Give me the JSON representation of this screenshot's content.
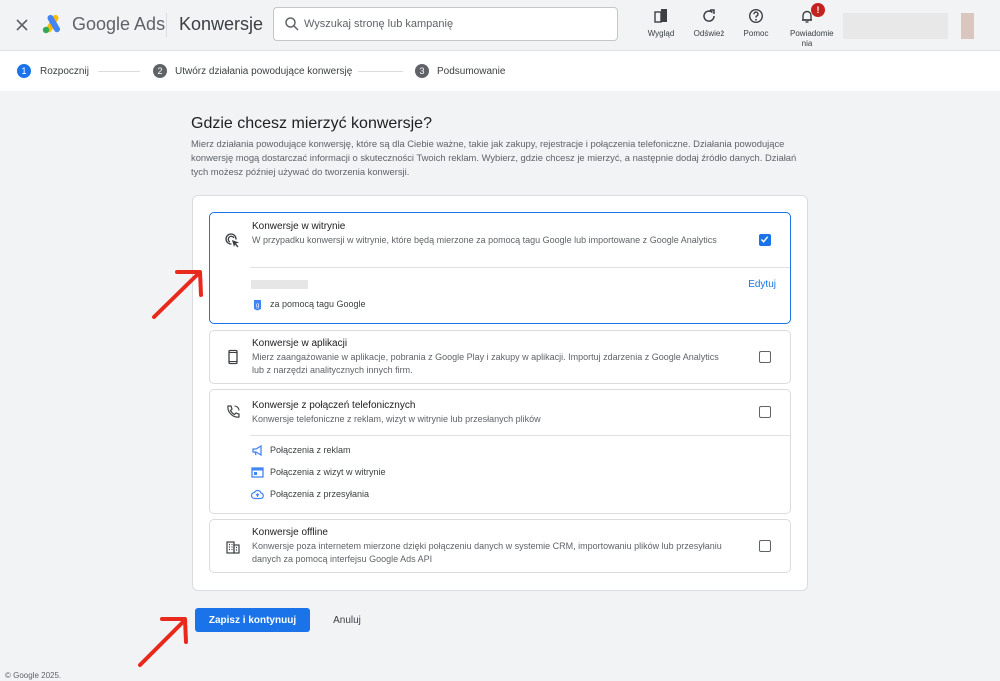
{
  "header": {
    "brand": "Google Ads",
    "page_title": "Konwersje",
    "search_placeholder": "Wyszukaj stronę lub kampanię",
    "tools": {
      "appearance": "Wygląd",
      "refresh": "Odśwież",
      "help": "Pomoc",
      "notifications": "Powiadomie nia",
      "notifications_badge": "!"
    }
  },
  "stepper": [
    {
      "num": "1",
      "label": "Rozpocznij"
    },
    {
      "num": "2",
      "label": "Utwórz działania powodujące konwersję"
    },
    {
      "num": "3",
      "label": "Podsumowanie"
    }
  ],
  "main": {
    "heading": "Gdzie chcesz mierzyć konwersje?",
    "intro": "Mierz działania powodujące konwersję, które są dla Ciebie ważne, takie jak zakupy, rejestracje i połączenia telefoniczne. Działania powodujące konwersję mogą dostarczać informacji o skuteczności Twoich reklam. Wybierz, gdzie chcesz je mierzyć, a następnie dodaj źródło danych. Działań tych możesz później używać do tworzenia konwersji."
  },
  "options": {
    "website": {
      "title": "Konwersje w witrynie",
      "desc": "W przypadku konwersji w witrynie, które będą mierzone za pomocą tagu Google lub importowane z Google Analytics",
      "edit": "Edytuj",
      "method": "za pomocą tagu Google",
      "checked": true
    },
    "app": {
      "title": "Konwersje w aplikacji",
      "desc": "Mierz zaangażowanie w aplikacje, pobrania z Google Play i zakupy w aplikacji. Importuj zdarzenia z Google Analytics lub z narzędzi analitycznych innych firm.",
      "checked": false
    },
    "calls": {
      "title": "Konwersje z połączeń telefonicznych",
      "desc": "Konwersje telefoniczne z reklam, wizyt w witrynie lub przesłanych plików",
      "sub": [
        "Połączenia z reklam",
        "Połączenia z wizyt w witrynie",
        "Połączenia z przesyłania"
      ],
      "checked": false
    },
    "offline": {
      "title": "Konwersje offline",
      "desc": "Konwersje poza internetem mierzone dzięki połączeniu danych w systemie CRM, importowaniu plików lub przesyłaniu danych za pomocą interfejsu Google Ads API",
      "checked": false
    }
  },
  "actions": {
    "save": "Zapisz i kontynuuj",
    "cancel": "Anuluj"
  },
  "footer": "© Google 2025.",
  "colors": {
    "accent": "#1a73e8",
    "annotation_arrow": "#e8291c",
    "background": "#f1f3f4"
  }
}
